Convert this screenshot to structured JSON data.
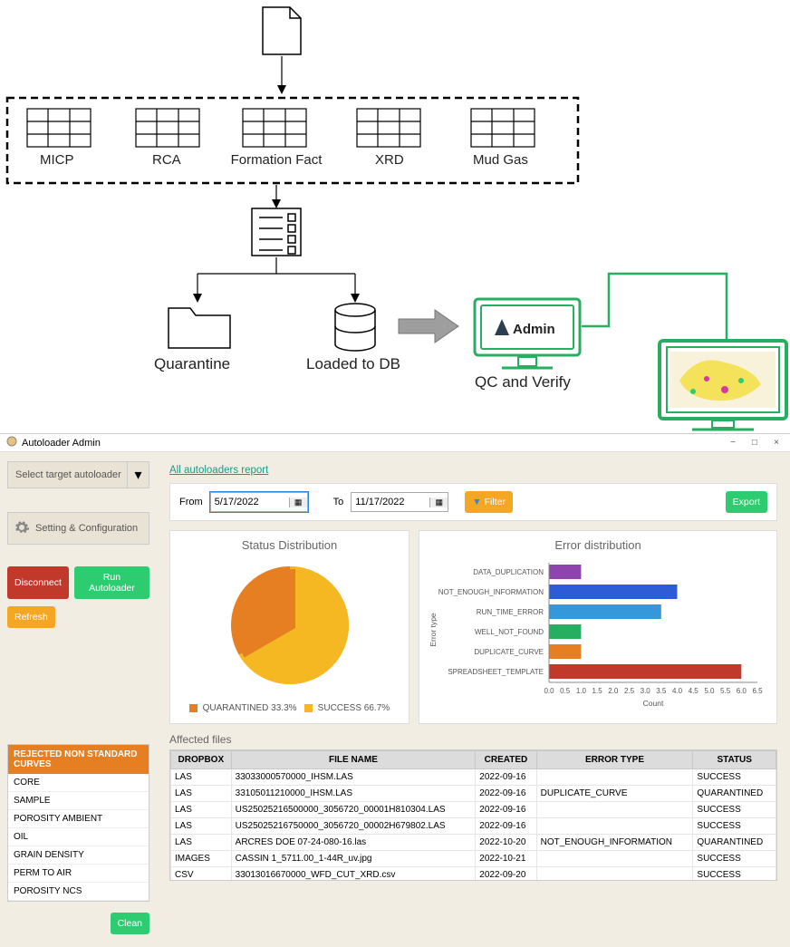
{
  "diagram": {
    "file_icon": "file",
    "dashed_boxes": [
      "MICP",
      "RCA",
      "Formation Fact",
      "XRD",
      "Mud Gas"
    ],
    "checklist_icon": "checklist",
    "quarantine_label": "Quarantine",
    "loaded_label": "Loaded to DB",
    "admin_label": "Admin",
    "qc_verify_label": "QC and Verify"
  },
  "app": {
    "title": "Autoloader Admin",
    "window_controls": {
      "minimize": "−",
      "maximize": "□",
      "close": "×"
    },
    "sidebar": {
      "target_dropdown": "Select target autoloader",
      "settings_label": "Setting & Configuration",
      "disconnect": "Disconnect",
      "run": "Run Autoloader",
      "refresh": "Refresh",
      "curves_header": "REJECTED NON STANDARD CURVES",
      "curves": [
        "CORE",
        "SAMPLE",
        "POROSITY AMBIENT",
        "OIL",
        "GRAIN DENSITY",
        "PERM TO AIR",
        "POROSITY NCS"
      ],
      "clean": "Clean"
    },
    "top_link": "All autoloaders report",
    "filter": {
      "from_label": "From",
      "from_value": "5/17/2022",
      "to_label": "To",
      "to_value": "11/17/2022",
      "filter_btn": "Filter",
      "export_btn": "Export"
    },
    "pie_title": "Status Distribution",
    "pie_legend": {
      "q_label": "QUARANTINED 33.3%",
      "s_label": "SUCCESS 66.7%"
    },
    "bar_title": "Error distribution",
    "bar_ylabel": "Error type",
    "bar_xlabel": "Count",
    "bar_ticks": [
      "0.0",
      "0.5",
      "1.0",
      "1.5",
      "2.0",
      "2.5",
      "3.0",
      "3.5",
      "4.0",
      "4.5",
      "5.0",
      "5.5",
      "6.0",
      "6.5"
    ],
    "bar_cats": {
      "c0": "DATA_DUPLICATION",
      "c1": "NOT_ENOUGH_INFORMATION",
      "c2": "RUN_TIME_ERROR",
      "c3": "WELL_NOT_FOUND",
      "c4": "DUPLICATE_CURVE",
      "c5": "SPREADSHEET_TEMPLATE"
    },
    "affected_title": "Affected files",
    "table": {
      "headers": {
        "h0": "DROPBOX",
        "h1": "FILE NAME",
        "h2": "CREATED",
        "h3": "ERROR TYPE",
        "h4": "STATUS"
      },
      "rows": [
        {
          "c0": "LAS",
          "c1": "33033000570000_IHSM.LAS",
          "c2": "2022-09-16",
          "c3": "",
          "c4": "SUCCESS"
        },
        {
          "c0": "LAS",
          "c1": "33105011210000_IHSM.LAS",
          "c2": "2022-09-16",
          "c3": "DUPLICATE_CURVE",
          "c4": "QUARANTINED"
        },
        {
          "c0": "LAS",
          "c1": "US25025216500000_3056720_00001H810304.LAS",
          "c2": "2022-09-16",
          "c3": "",
          "c4": "SUCCESS"
        },
        {
          "c0": "LAS",
          "c1": "US25025216750000_3056720_00002H679802.LAS",
          "c2": "2022-09-16",
          "c3": "",
          "c4": "SUCCESS"
        },
        {
          "c0": "LAS",
          "c1": "ARCRES DOE 07-24-080-16.las",
          "c2": "2022-10-20",
          "c3": "NOT_ENOUGH_INFORMATION",
          "c4": "QUARANTINED"
        },
        {
          "c0": "IMAGES",
          "c1": "CASSIN 1_5711.00_1-44R_uv.jpg",
          "c2": "2022-10-21",
          "c3": "",
          "c4": "SUCCESS"
        },
        {
          "c0": "CSV",
          "c1": "33013016670000_WFD_CUT_XRD.csv",
          "c2": "2022-09-20",
          "c3": "",
          "c4": "SUCCESS"
        }
      ]
    }
  },
  "chart_data": [
    {
      "type": "pie",
      "title": "Status Distribution",
      "categories": [
        "QUARANTINED",
        "SUCCESS"
      ],
      "values": [
        33.3,
        66.7
      ],
      "colors": [
        "#e67e22",
        "#f5b823"
      ]
    },
    {
      "type": "bar",
      "orientation": "horizontal",
      "title": "Error distribution",
      "xlabel": "Count",
      "ylabel": "Error type",
      "xlim": [
        0,
        6.5
      ],
      "categories": [
        "DATA_DUPLICATION",
        "NOT_ENOUGH_INFORMATION",
        "RUN_TIME_ERROR",
        "WELL_NOT_FOUND",
        "DUPLICATE_CURVE",
        "SPREADSHEET_TEMPLATE"
      ],
      "values": [
        1.0,
        4.0,
        3.5,
        1.0,
        1.0,
        6.0
      ],
      "colors": [
        "#8e44ad",
        "#2e5cd6",
        "#3498db",
        "#27ae60",
        "#e67e22",
        "#c0392b"
      ]
    }
  ]
}
